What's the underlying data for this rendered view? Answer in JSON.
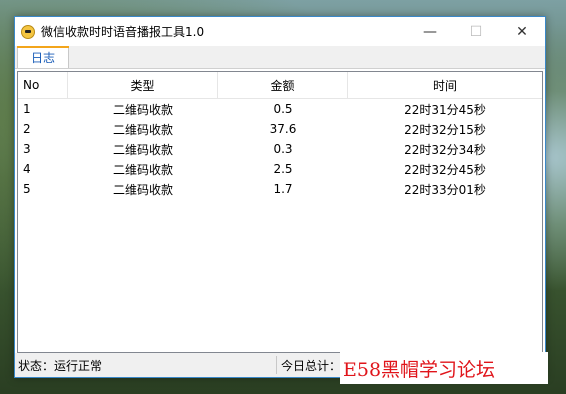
{
  "window": {
    "title": "微信收款时时语音播报工具1.0",
    "minimize": "—",
    "maximize": "☐",
    "close": "✕"
  },
  "tabs": [
    {
      "label": "日志",
      "active": true
    }
  ],
  "table": {
    "columns": [
      "No",
      "类型",
      "金额",
      "时间"
    ],
    "rows": [
      [
        "1",
        "二维码收款",
        "0.5",
        "22时31分45秒"
      ],
      [
        "2",
        "二维码收款",
        "37.6",
        "22时32分15秒"
      ],
      [
        "3",
        "二维码收款",
        "0.3",
        "22时32分34秒"
      ],
      [
        "4",
        "二维码收款",
        "2.5",
        "22时32分45秒"
      ],
      [
        "5",
        "二维码收款",
        "1.7",
        "22时33分01秒"
      ]
    ]
  },
  "status": {
    "state": "状态：运行正常",
    "today_total": "今日总计："
  },
  "watermark": "E58黑帽学习论坛",
  "colors": {
    "tab_accent": "#f3a51b",
    "tab_text": "#1a5db8",
    "watermark": "#e0141a"
  }
}
